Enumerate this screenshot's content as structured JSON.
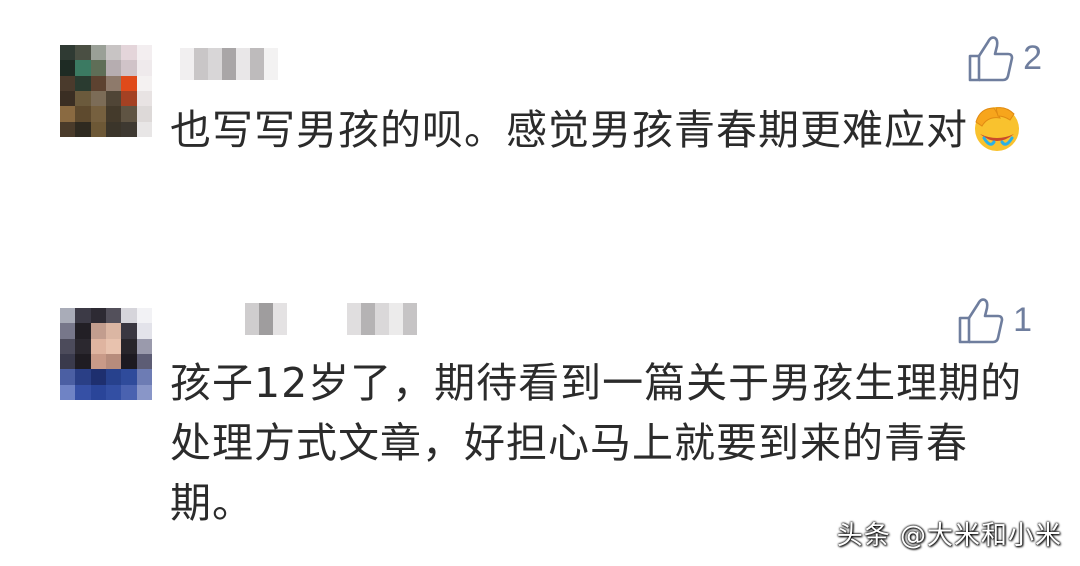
{
  "comments": [
    {
      "likes": "2",
      "text": "也写写男孩的呗。感觉男孩青春期更难应对",
      "emoji": "face-with-hand-over-eyes-emoji"
    },
    {
      "likes": "1",
      "text": "孩子12岁了，期待看到一篇关于男孩生理期的处理方式文章，好担心马上就要到来的青春期。"
    }
  ],
  "watermark": "头条 @大米和小米",
  "colors": {
    "like_icon": "#6f7e9e",
    "text": "#2b2b2b",
    "background": "#ffffff"
  },
  "icons": {
    "like": "thumbs-up-outline-icon"
  }
}
